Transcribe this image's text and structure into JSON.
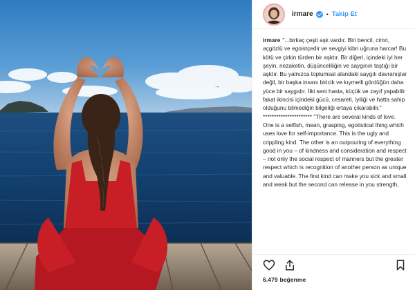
{
  "post": {
    "author": "irmare",
    "follow_label": "Takip Et",
    "separator": "•",
    "caption_author": "irmare",
    "caption_text": "\"...birkaç çeşit aşk vardır. Biri bencil, cimri, açgözlü ve egoistçedir ve sevgiyi kibri uğruna harcar! Bu kötü ve çirkin türden bir aşktır. Bir diğeri, içindeki iyi her şeyin, nezaketin, düşünceliliğin ve saygının taştığı bir aşktır. Bu yalnızca toplumsal alandaki saygılı davranışlar değil, bir başka insanı biricik ve kıymetli gördüğün daha yüce bir saygıdır. İlki seni hasta, küçük ve zayıf yapabilir fakat ikincisi içindeki gücü, cesareti, iyiliği ve hatta sahip olduğunu bilmediğin bilgeliği ortaya çıkarabilir.\" ********************** \"There are several kinds of love. One is a selfish, mean, grasping, egotistical thing which uses love for self-importance. This is the ugly and crippling kind. The other is an outpouring of everything good in you – of kindness and consideration and respect – not only the social respect of manners but the greater respect which is recognition of another person as unique and valuable. The first kind can make you sick and small and weak but the second can release in you strength,",
    "likes_count": "6.479",
    "likes_label": "beğenme"
  },
  "icons": {
    "verified": "verified-badge-icon",
    "like": "heart-icon",
    "share": "share-icon",
    "save": "bookmark-icon"
  },
  "colors": {
    "accent": "#3897f0",
    "sea": "#123a66",
    "sky": "#3b86c8",
    "dress": "#c81e26",
    "deck": "#8e7c69"
  }
}
